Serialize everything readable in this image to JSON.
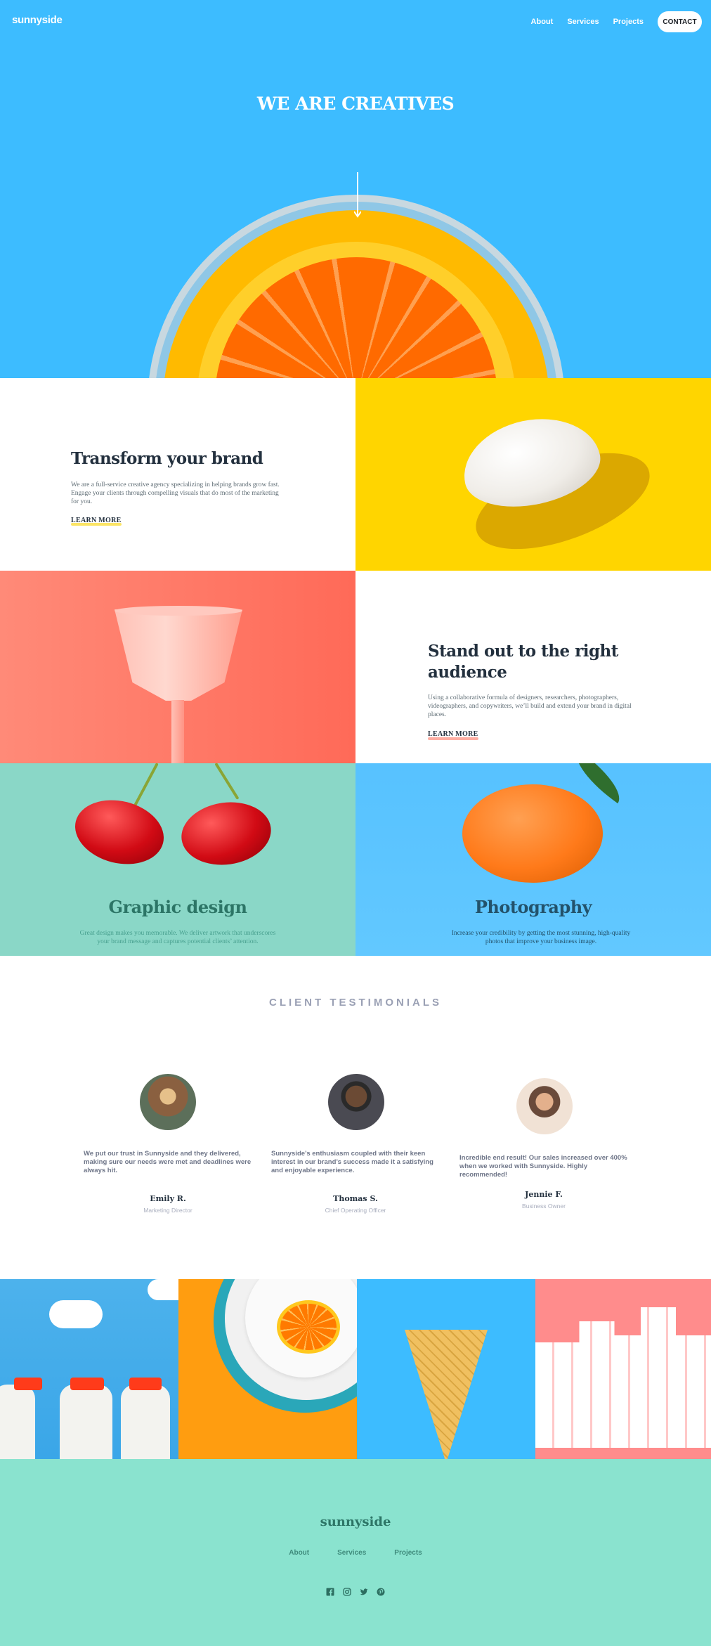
{
  "header": {
    "logo": "sunnyside",
    "nav": [
      "About",
      "Services",
      "Projects"
    ],
    "contact": "CONTACT"
  },
  "hero": {
    "title": "WE ARE CREATIVES",
    "arrow_icon": "arrow-down-icon"
  },
  "features": [
    {
      "title": "Transform your brand",
      "description": "We are a full-service creative agency specializing in helping brands grow fast. Engage your clients through compelling visuals that do most of the marketing for you.",
      "link": "LEARN MORE",
      "accent": "#fad400"
    },
    {
      "title": "Stand out to the right audience",
      "description": "Using a collaborative formula of designers, researchers, photographers, videographers, and copywriters, we’ll build and extend your brand in digital places.",
      "link": "LEARN MORE",
      "accent": "#fe7865"
    }
  ],
  "services": [
    {
      "title": "Graphic design",
      "description": "Great design makes you memorable. We deliver artwork that underscores your brand message and captures potential clients’ attention.",
      "text_color": "#2c7566"
    },
    {
      "title": "Photography",
      "description": "Increase your credibility by getting the most stunning, high-quality photos that improve your business image.",
      "text_color": "#23526b"
    }
  ],
  "testimonials": {
    "heading": "CLIENT TESTIMONIALS",
    "items": [
      {
        "quote": "We put our trust in Sunnyside and they delivered, making sure our needs were met and deadlines were always hit.",
        "name": "Emily R.",
        "role": "Marketing Director"
      },
      {
        "quote": "Sunnyside’s enthusiasm coupled with their keen interest in our brand’s success made it a satisfying and enjoyable experience.",
        "name": "Thomas S.",
        "role": "Chief Operating Officer"
      },
      {
        "quote": "Incredible end result! Our sales increased over 400% when we worked with Sunnyside. Highly recommended!",
        "name": "Jennie F.",
        "role": "Business Owner"
      }
    ]
  },
  "footer": {
    "logo": "sunnyside",
    "nav": [
      "About",
      "Services",
      "Projects"
    ],
    "socials": [
      "facebook-icon",
      "instagram-icon",
      "twitter-icon",
      "pinterest-icon"
    ]
  },
  "colors": {
    "hero_bg": "#3dbcff",
    "footer_bg": "#8ae3cf"
  }
}
